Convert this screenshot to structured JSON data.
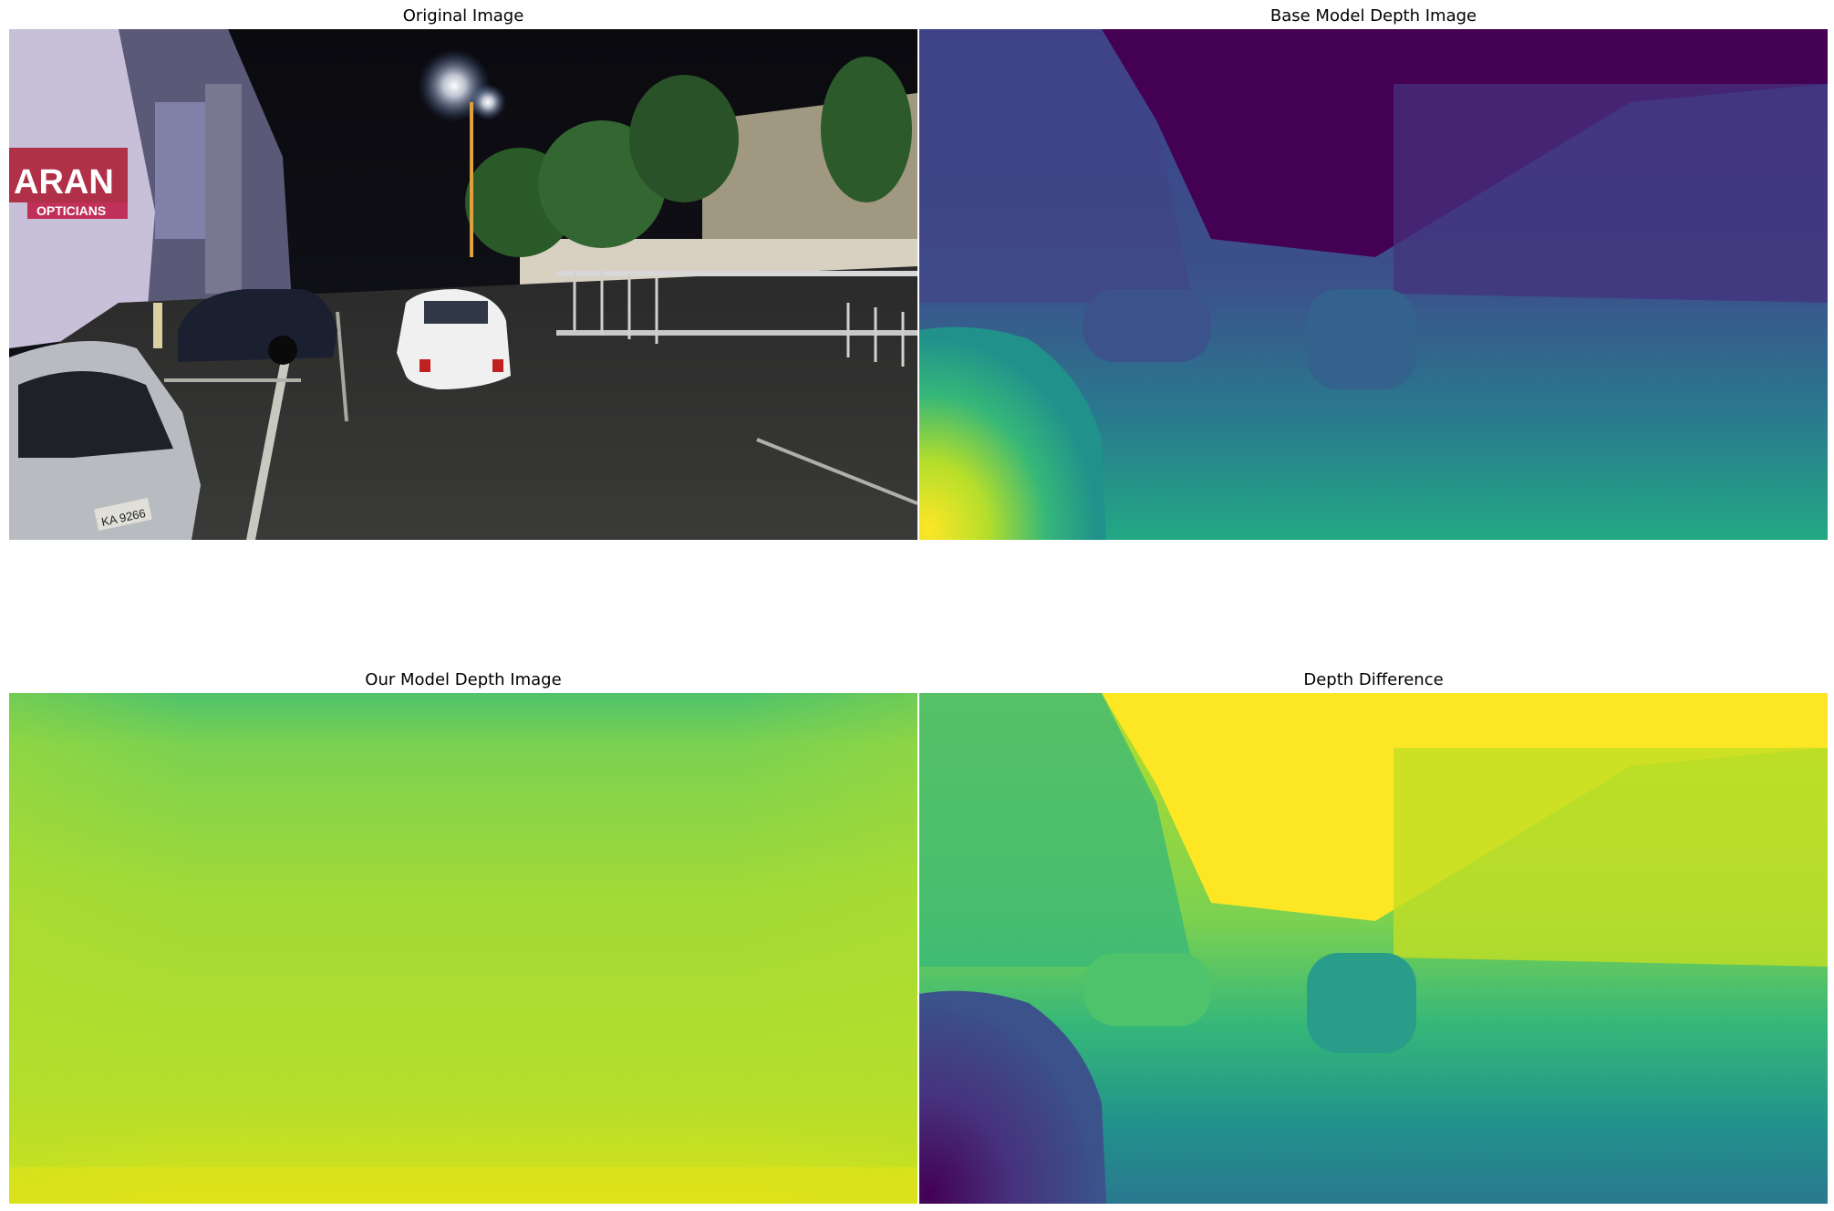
{
  "figure": {
    "panels": [
      {
        "title": "Original Image",
        "content": "night street photo"
      },
      {
        "title": "Base Model Depth Image",
        "content": "viridis depth map"
      },
      {
        "title": "Our Model Depth Image",
        "content": "viridis depth map (near-uniform)"
      },
      {
        "title": "Depth Difference",
        "content": "viridis difference map"
      }
    ],
    "photo_text": {
      "shop_sign": "ARAN",
      "shop_sub": "OPTICIANS",
      "plate": "KA 9266"
    },
    "colors": {
      "viridis_dark": "#440154",
      "viridis_blue": "#3b528b",
      "viridis_teal": "#21918c",
      "viridis_green": "#5ec962",
      "viridis_yellow": "#fde725"
    }
  }
}
